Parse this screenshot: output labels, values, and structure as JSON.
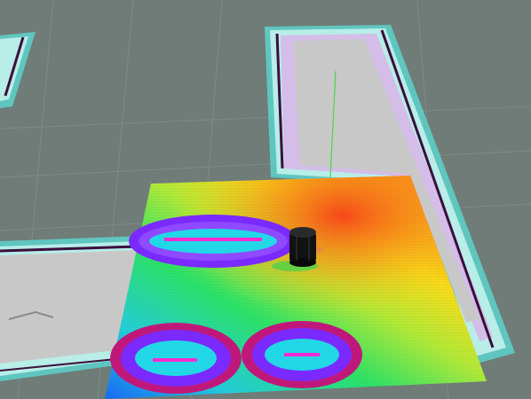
{
  "scene": {
    "background": "#6f7c78",
    "grid_color": "#8a9591",
    "map": {
      "inflation_color": "#b8ede8",
      "inflation_outer": "#5fc6bf",
      "free_color": "#c8c8c8",
      "cost_halo": "#c8a8e0",
      "obstacle_color": "#3a0e3c"
    },
    "costmap": {
      "gradient_stops": [
        "#1a6cff",
        "#24d4e0",
        "#2ee86a",
        "#b6f03a",
        "#ffe21a",
        "#ff9a1a",
        "#ff3a1a"
      ],
      "lethal_core": "#ff2ad0",
      "obstacle_ring_inner": "#7a2aff",
      "obstacle_ring_outer": "#c0187a"
    },
    "robot": {
      "color": "#121212",
      "marker": "#e58b3b"
    },
    "path_color": "#4dd24a"
  }
}
